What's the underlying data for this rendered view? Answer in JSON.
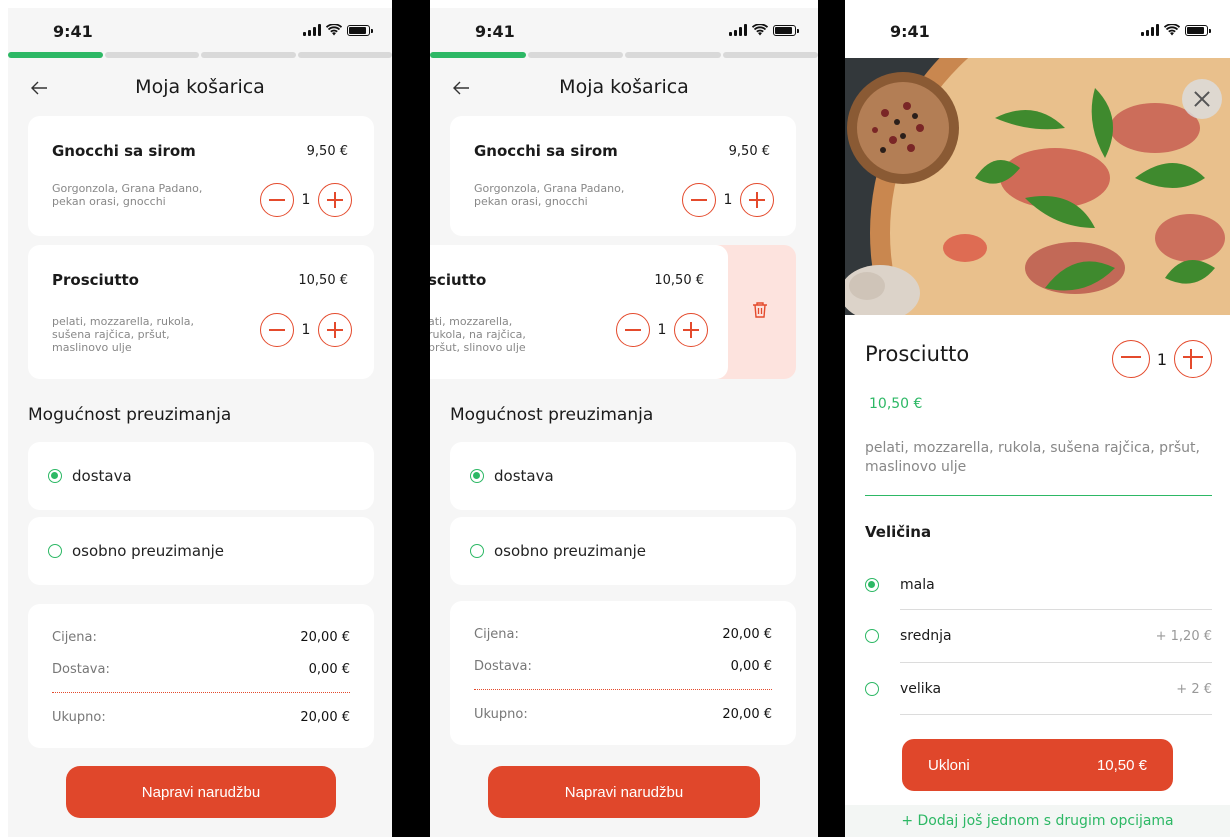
{
  "status": {
    "time": "9:41"
  },
  "cart": {
    "title": "Moja košarica",
    "items": [
      {
        "name": "Gnocchi sa sirom",
        "price": "9,50 €",
        "description": "Gorgonzola, Grana Padano, pekan orasi, gnocchi",
        "quantity": "1"
      },
      {
        "name": "Prosciutto",
        "price": "10,50 €",
        "description": "pelati, mozzarella, rukola, sušena rajčica, pršut, maslinovo ulje",
        "quantity": "1"
      }
    ],
    "swiped_item": {
      "name": "Prosciutto",
      "name_visible": "sciutto",
      "price": "10,50 €",
      "description": "ati, mozzarella, rukola, na rajčica, pršut, slinovo ulje",
      "quantity": "1"
    },
    "pickup_title": "Mogućnost preuzimanja",
    "pickup_options": [
      {
        "label": "dostava",
        "selected": true
      },
      {
        "label": "osobno preuzimanje",
        "selected": false
      }
    ],
    "totals": {
      "price_label": "Cijena:",
      "price_value": "20,00 €",
      "delivery_label": "Dostava:",
      "delivery_value": "0,00 €",
      "total_label": "Ukupno:",
      "total_value": "20,00 €"
    },
    "order_button": "Napravi narudžbu"
  },
  "product": {
    "name": "Prosciutto",
    "price": "10,50 €",
    "quantity": "1",
    "description": "pelati, mozzarella, rukola, sušena rajčica, pršut, maslinovo ulje",
    "size_title": "Veličina",
    "sizes": [
      {
        "label": "mala",
        "extra": "",
        "selected": true
      },
      {
        "label": "srednja",
        "extra": "+ 1,20 €",
        "selected": false
      },
      {
        "label": "velika",
        "extra": "+ 2 €",
        "selected": false
      }
    ],
    "remove_label": "Ukloni",
    "remove_price": "10,50 €",
    "add_again": "+ Dodaj još jednom s drugim opcijama"
  },
  "colors": {
    "accent": "#e0472b",
    "green": "#2db865",
    "swipe_bg": "#fde3de"
  }
}
